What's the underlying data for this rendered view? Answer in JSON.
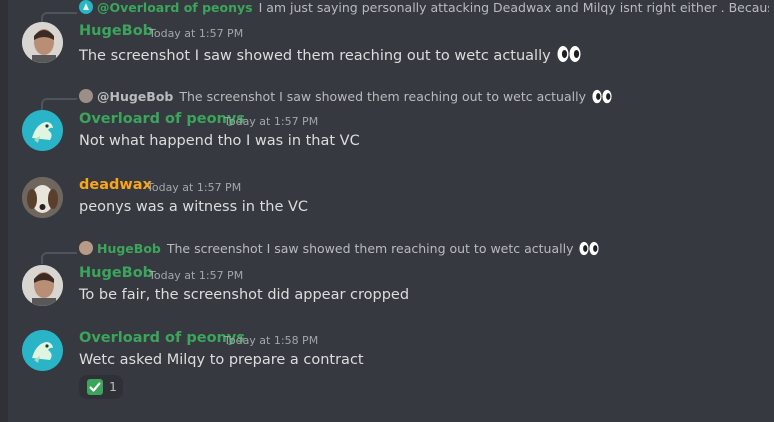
{
  "messages": [
    {
      "reply": {
        "name": "@Overloard of peonys",
        "text": "I am just saying personally attacking Deadwax and Milqy isnt right either . Because wetc ca..."
      },
      "author": "HugeBob",
      "time": "Today at 1:57 PM",
      "content": "The screenshot I saw showed them reaching out to wetc actually"
    },
    {
      "reply": {
        "name": "@HugeBob",
        "text": "The screenshot I saw showed them reaching out to wetc actually"
      },
      "author": "Overloard of peonys",
      "time": "Today at 1:57 PM",
      "content": "Not what happend tho I was in that VC"
    },
    {
      "author": "deadwax",
      "time": "Today at 1:57 PM",
      "content": "peonys was a witness in the VC"
    },
    {
      "reply": {
        "name": "HugeBob",
        "text": "The screenshot I saw showed them reaching out to wetc actually"
      },
      "author": "HugeBob",
      "time": "Today at 1:57 PM",
      "content": "To be fair, the screenshot did appear cropped"
    },
    {
      "author": "Overloard of peonys",
      "time": "Today at 1:58 PM",
      "content": "Wetc asked Milqy to prepare a contract",
      "reaction": {
        "icon": "check-mark-button",
        "count": "1"
      }
    }
  ],
  "colors": {
    "background": "#36393f",
    "hugebob_name": "#3ba55c",
    "overloard_name": "#3ba55c",
    "deadwax_name": "#faa61a",
    "text": "#dcddde",
    "timestamp": "#a3a6aa"
  }
}
